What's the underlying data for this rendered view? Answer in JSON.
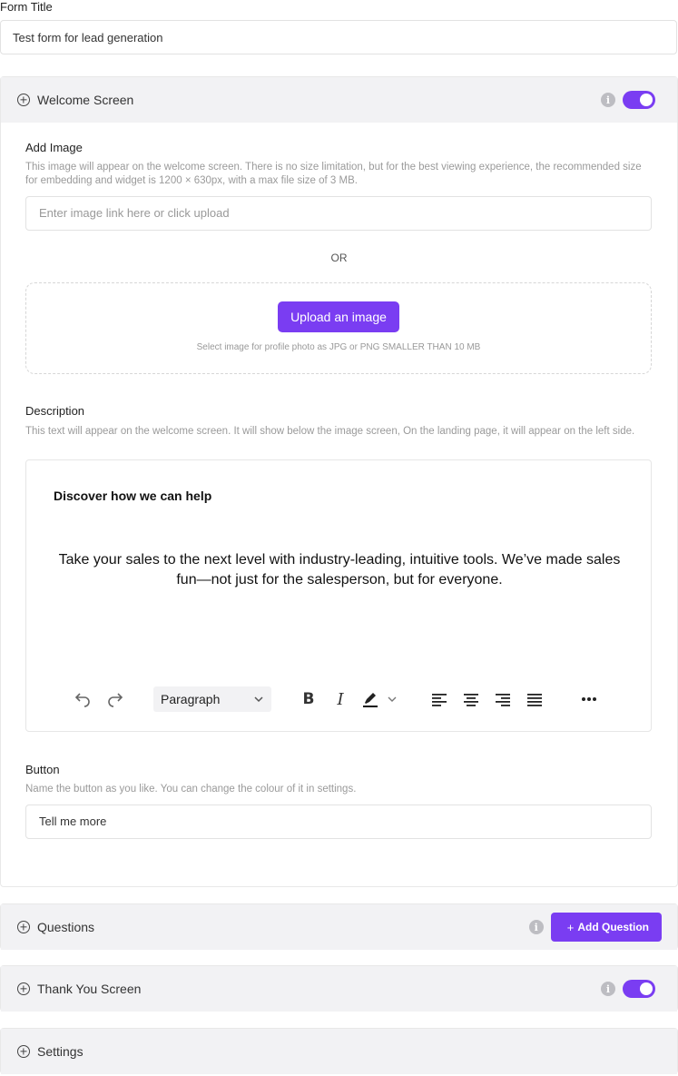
{
  "form_title": {
    "label": "Form Title",
    "value": "Test form for lead generation"
  },
  "welcome": {
    "title": "Welcome Screen",
    "info_icon": "info-icon",
    "toggle_on": true,
    "add_image": {
      "label": "Add Image",
      "help": "This image will appear on the welcome screen. There is no size limitation, but for the best viewing experience, the recommended size for embedding and widget is 1200 × 630px, with a max file size of 3 MB.",
      "placeholder": "Enter image link here or click upload",
      "or": "OR",
      "upload_label": "Upload an image",
      "upload_hint": "Select image for profile photo as JPG or PNG SMALLER THAN 10 MB"
    },
    "description": {
      "label": "Description",
      "help": "This text will appear on the welcome screen. It will show below the image screen, On the landing page, it will appear on the left side.",
      "heading": "Discover how we can help",
      "body": "Take your sales to the next level with industry-leading, intuitive tools. We’ve made sales fun—not just for the salesperson, but for everyone.",
      "toolbar": {
        "block_format": "Paragraph",
        "tools": [
          "undo-icon",
          "redo-icon",
          "bold-icon",
          "italic-icon",
          "highlight-icon",
          "align-left-icon",
          "align-center-icon",
          "align-right-icon",
          "justify-icon",
          "more-icon"
        ]
      }
    },
    "button": {
      "label": "Button",
      "help": "Name the button as you like. You can change the colour of it in settings.",
      "value": "Tell me more"
    }
  },
  "questions": {
    "title": "Questions",
    "add_label": "Add Question",
    "add_prefix": "+"
  },
  "thank_you": {
    "title": "Thank You Screen",
    "toggle_on": true
  },
  "settings": {
    "title": "Settings"
  },
  "colors": {
    "accent": "#7a3df2",
    "header_bg": "#f2f2f4"
  }
}
